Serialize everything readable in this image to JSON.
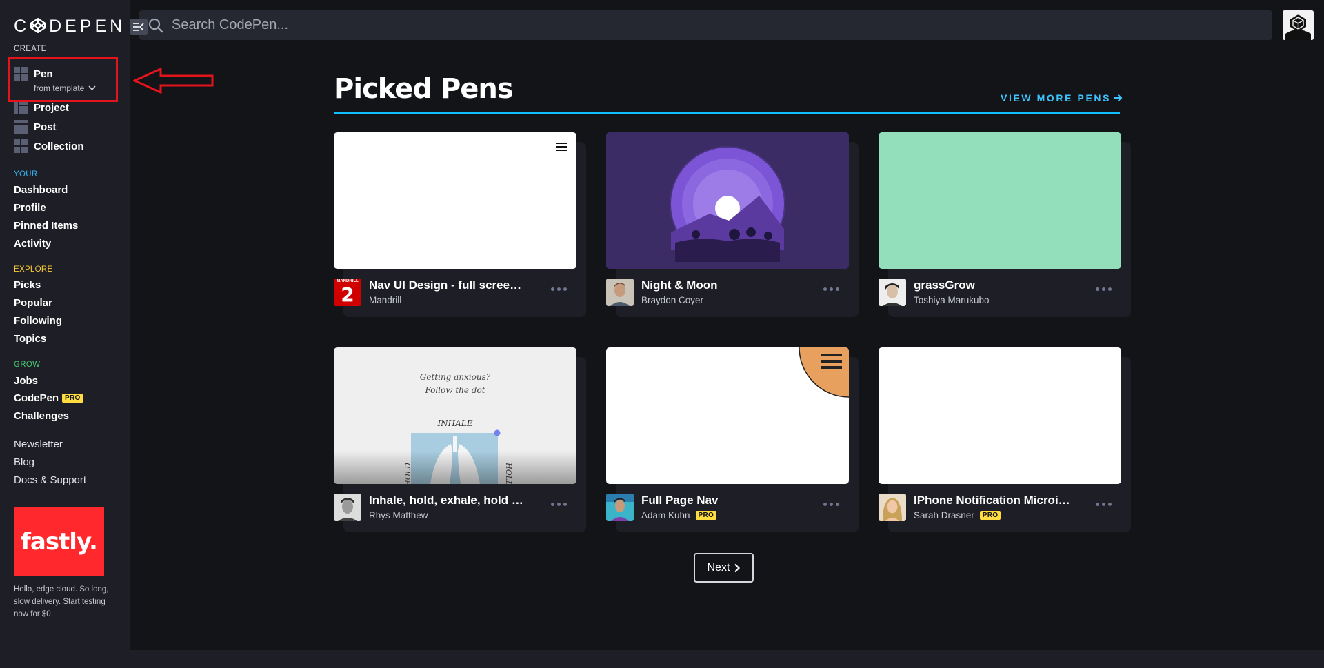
{
  "brand": {
    "logo_text": "CODEPEN"
  },
  "sidebar": {
    "create_label": "CREATE",
    "create_items": [
      {
        "label": "Pen",
        "icon": "pen-grid-icon"
      },
      {
        "label": "Project",
        "icon": "project-icon"
      },
      {
        "label": "Post",
        "icon": "post-icon"
      },
      {
        "label": "Collection",
        "icon": "collection-icon"
      }
    ],
    "pen_sub_label": "from template",
    "your_label": "YOUR",
    "your_items": [
      "Dashboard",
      "Profile",
      "Pinned Items",
      "Activity"
    ],
    "explore_label": "EXPLORE",
    "explore_items": [
      "Picks",
      "Popular",
      "Following",
      "Topics"
    ],
    "grow_label": "GROW",
    "grow_items": [
      "Jobs",
      "CodePen",
      "Challenges"
    ],
    "pro_badge": "PRO",
    "misc_items": [
      "Newsletter",
      "Blog",
      "Docs & Support"
    ],
    "ad": {
      "brand": "fastly.",
      "text": "Hello, edge cloud. So long, slow delivery. Start testing now for $0.",
      "color": "#ff282d"
    }
  },
  "search": {
    "placeholder": "Search CodePen..."
  },
  "main": {
    "title": "Picked Pens",
    "view_more": "VIEW MORE PENS",
    "accent_color": "#0ebeff",
    "cards": [
      {
        "title": "Nav UI Design - full screen v...",
        "author": "Mandrill",
        "pro": false,
        "thumb": "white-menu"
      },
      {
        "title": "Night & Moon",
        "author": "Braydon Coyer",
        "pro": false,
        "thumb": "night-moon"
      },
      {
        "title": "grassGrow",
        "author": "Toshiya Marukubo",
        "pro": false,
        "thumb": "mint"
      },
      {
        "title": "Inhale, hold, exhale, hold an...",
        "author": "Rhys Matthew",
        "pro": false,
        "thumb": "breathing",
        "thumb_text": {
          "line1": "Getting anxious?",
          "line2": "Follow the dot",
          "inhale": "INHALE",
          "hold": "HOLD"
        }
      },
      {
        "title": "Full Page Nav",
        "author": "Adam Kuhn",
        "pro": true,
        "thumb": "orange-corner"
      },
      {
        "title": "IPhone Notification Microin...",
        "author": "Sarah Drasner",
        "pro": true,
        "thumb": "white"
      }
    ],
    "mandrill_badge_top": "MANDRILL",
    "mandrill_badge_num": "2",
    "next_label": "Next"
  }
}
